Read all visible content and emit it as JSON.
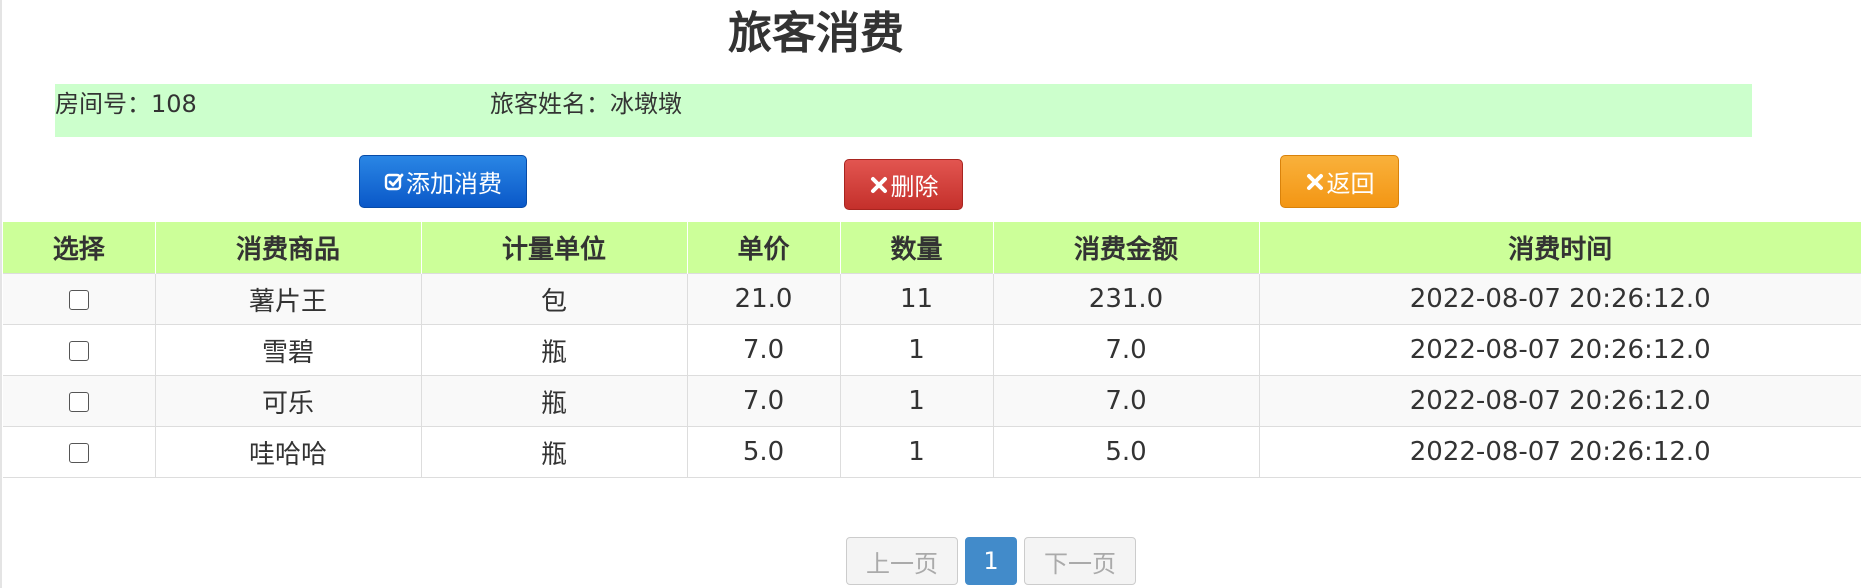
{
  "title": "旅客消费",
  "info": {
    "room_label": "房间号：",
    "room_value": "108",
    "name_label": "旅客姓名：",
    "name_value": "冰墩墩"
  },
  "toolbar": {
    "add_label": "添加消费",
    "add_icon": "check-square-icon",
    "delete_label": "删除",
    "delete_icon": "close-icon",
    "back_label": "返回",
    "back_icon": "close-icon"
  },
  "table": {
    "columns": [
      "选择",
      "消费商品",
      "计量单位",
      "单价",
      "数量",
      "消费金额",
      "消费时间"
    ],
    "rows": [
      {
        "product": "薯片王",
        "unit": "包",
        "price": "21.0",
        "qty": "11",
        "amount": "231.0",
        "time": "2022-08-07 20:26:12.0"
      },
      {
        "product": "雪碧",
        "unit": "瓶",
        "price": "7.0",
        "qty": "1",
        "amount": "7.0",
        "time": "2022-08-07 20:26:12.0"
      },
      {
        "product": "可乐",
        "unit": "瓶",
        "price": "7.0",
        "qty": "1",
        "amount": "7.0",
        "time": "2022-08-07 20:26:12.0"
      },
      {
        "product": "哇哈哈",
        "unit": "瓶",
        "price": "5.0",
        "qty": "1",
        "amount": "5.0",
        "time": "2022-08-07 20:26:12.0"
      }
    ]
  },
  "pagination": {
    "prev_label": "上一页",
    "current_page": "1",
    "next_label": "下一页"
  },
  "colors": {
    "info_bg": "#ccffcc",
    "header_bg": "#ccff99",
    "add_button": "#0a58c8",
    "delete_button": "#c4302b",
    "back_button": "#f39614",
    "page_active": "#428bca"
  }
}
